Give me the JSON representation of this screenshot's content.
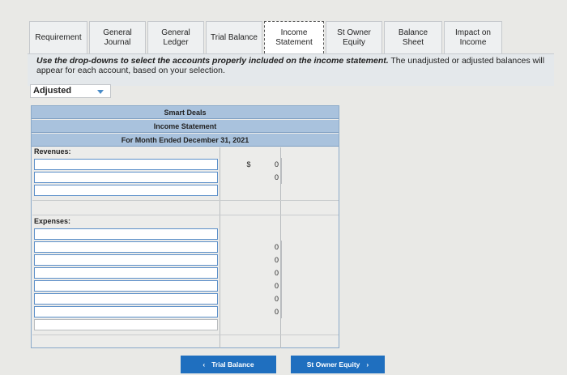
{
  "tabs": [
    {
      "label": "Requirement",
      "active": false
    },
    {
      "label": "General\nJournal",
      "active": false
    },
    {
      "label": "General\nLedger",
      "active": false
    },
    {
      "label": "Trial Balance",
      "active": false
    },
    {
      "label": "Income\nStatement",
      "active": true
    },
    {
      "label": "St Owner\nEquity",
      "active": false
    },
    {
      "label": "Balance Sheet",
      "active": false
    },
    {
      "label": "Impact on\nIncome",
      "active": false
    }
  ],
  "instructions": {
    "bold": "Use the drop-downs to select the accounts properly included on the income statement.",
    "rest": " The unadjusted or adjusted balances will appear for each account, based on your selection."
  },
  "dropdown": {
    "selected": "Adjusted"
  },
  "statement": {
    "company": "Smart Deals",
    "title": "Income Statement",
    "period": "For Month Ended December 31, 2021",
    "revenues_label": "Revenues:",
    "expenses_label": "Expenses:",
    "currency_symbol": "$",
    "revenue_values": [
      "0",
      "0"
    ],
    "expense_values": [
      "0",
      "0",
      "0",
      "0",
      "0",
      "0"
    ]
  },
  "nav": {
    "prev_label": "Trial Balance",
    "next_label": "St Owner Equity",
    "prev_arrow": "‹",
    "next_arrow": "›"
  },
  "colors": {
    "accent": "#1f6fbf",
    "header": "#a9c2dd"
  }
}
